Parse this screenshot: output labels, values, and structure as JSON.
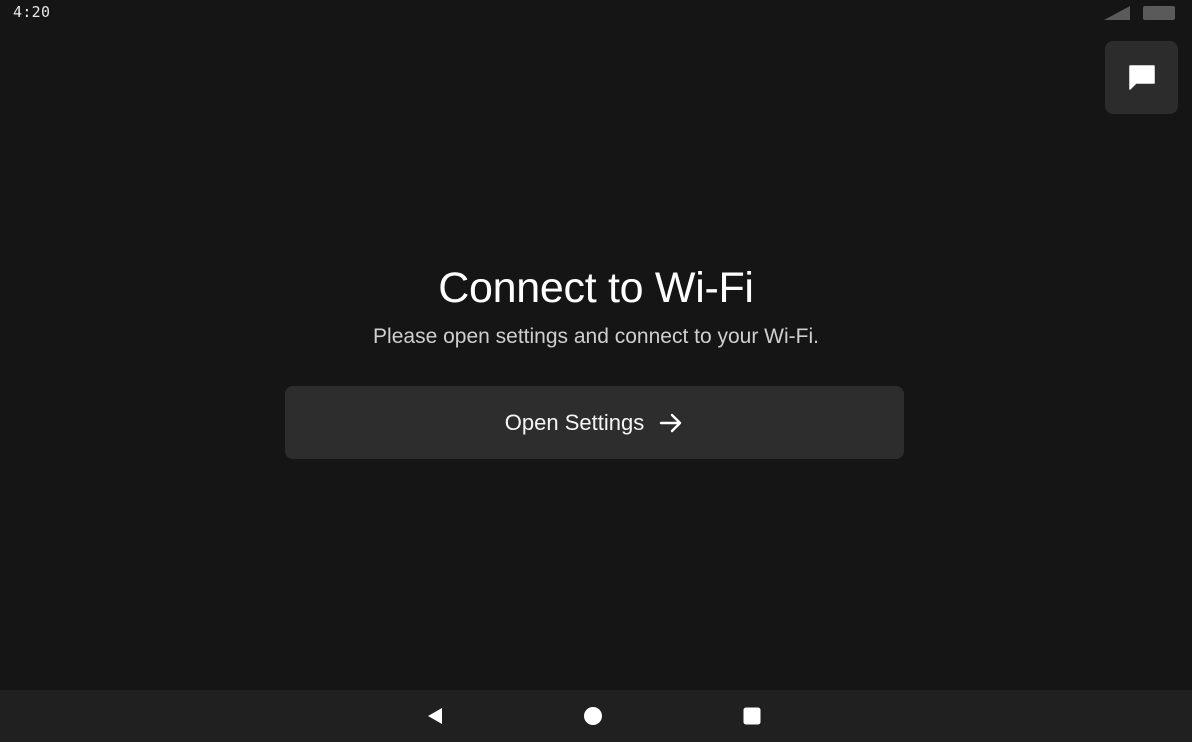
{
  "status_bar": {
    "time": "4:20",
    "icons": [
      "signal-icon",
      "battery-icon"
    ]
  },
  "chat_button": {
    "icon": "chat-icon"
  },
  "main": {
    "title": "Connect to Wi-Fi",
    "subtitle": "Please open settings and connect to your Wi-Fi.",
    "open_settings_label": "Open Settings",
    "open_settings_icon": "arrow-right-icon"
  },
  "nav_bar": {
    "buttons": [
      "back-icon",
      "home-icon",
      "recents-icon"
    ]
  },
  "colors": {
    "background": "#151515",
    "button_background": "#2d2d2d",
    "nav_background": "#202020",
    "text_primary": "#ffffff",
    "text_secondary": "#cfcfcf"
  }
}
